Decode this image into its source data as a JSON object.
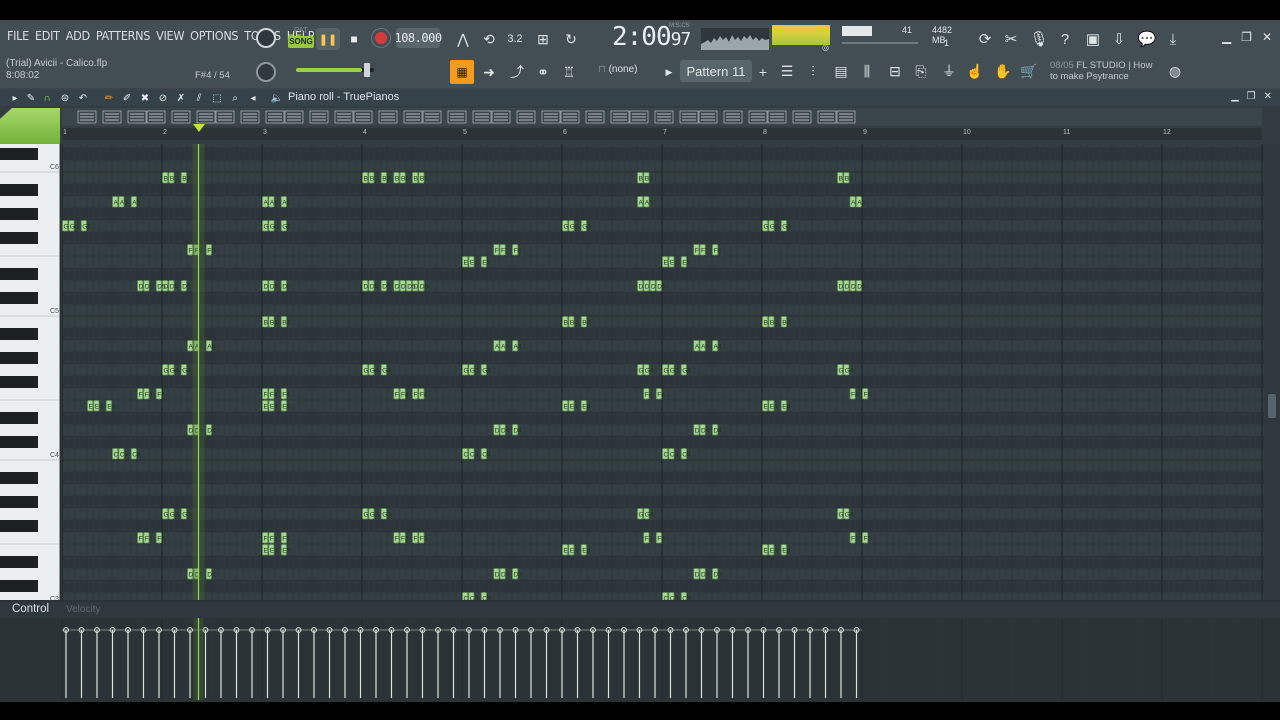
{
  "menu": [
    "FILE",
    "EDIT",
    "ADD",
    "PATTERNS",
    "VIEW",
    "OPTIONS",
    "TOOLS",
    "HELP"
  ],
  "project": {
    "title": "(Trial) Avicii - Calico.flp",
    "time": "8:08:02",
    "note_hint": "F#4 / 54"
  },
  "transport": {
    "pat_label": "PAT",
    "song_label": "SONG",
    "tempo": "108.000",
    "time_main": "2:00",
    "time_small": "97",
    "time_label": "M:S:CS"
  },
  "meters": {
    "polyphony": "41",
    "memory": "4482 MB",
    "cpu_num": "1"
  },
  "toolbar2": {
    "snap": "(none)",
    "pattern": "Pattern 11",
    "hint_date": "08/05",
    "hint_text": "FL STUDIO | How to make Psytrance"
  },
  "piano_roll": {
    "title": "Piano roll - TruePianos"
  },
  "ruler": [
    "1",
    "2",
    "3",
    "4",
    "5",
    "6",
    "7",
    "8",
    "9",
    "10",
    "11",
    "12"
  ],
  "octave_labels": [
    "C6",
    "C5",
    "C4",
    "C3"
  ],
  "control": {
    "label": "Control",
    "velocity": "Velocity"
  },
  "colors": {
    "note_fill": "#a6d596",
    "note_border": "#5f8e53",
    "playhead": "#8ed85a",
    "accent": "#f59a1a"
  },
  "icons": [
    "menu-arrow-icon",
    "magnet-icon",
    "pencil-icon",
    "brush-icon",
    "eraser-icon",
    "mute-icon",
    "slice-icon",
    "select-icon",
    "zoom-icon",
    "speaker-icon"
  ],
  "notes": [
    {
      "b": 0,
      "s": 0,
      "l": 1,
      "n": "G5"
    },
    {
      "b": 0,
      "s": 1,
      "l": 1,
      "n": "G5"
    },
    {
      "b": 0,
      "s": 3,
      "l": 1,
      "n": "G5"
    },
    {
      "b": 0,
      "s": 4,
      "l": 1,
      "n": "E4"
    },
    {
      "b": 0,
      "s": 5,
      "l": 1,
      "n": "E4"
    },
    {
      "b": 0,
      "s": 7,
      "l": 1,
      "n": "E4"
    },
    {
      "b": 0,
      "s": 8,
      "l": 1,
      "n": "C4"
    },
    {
      "b": 0,
      "s": 9,
      "l": 1,
      "n": "C4"
    },
    {
      "b": 0,
      "s": 11,
      "l": 1,
      "n": "C4"
    }
  ]
}
